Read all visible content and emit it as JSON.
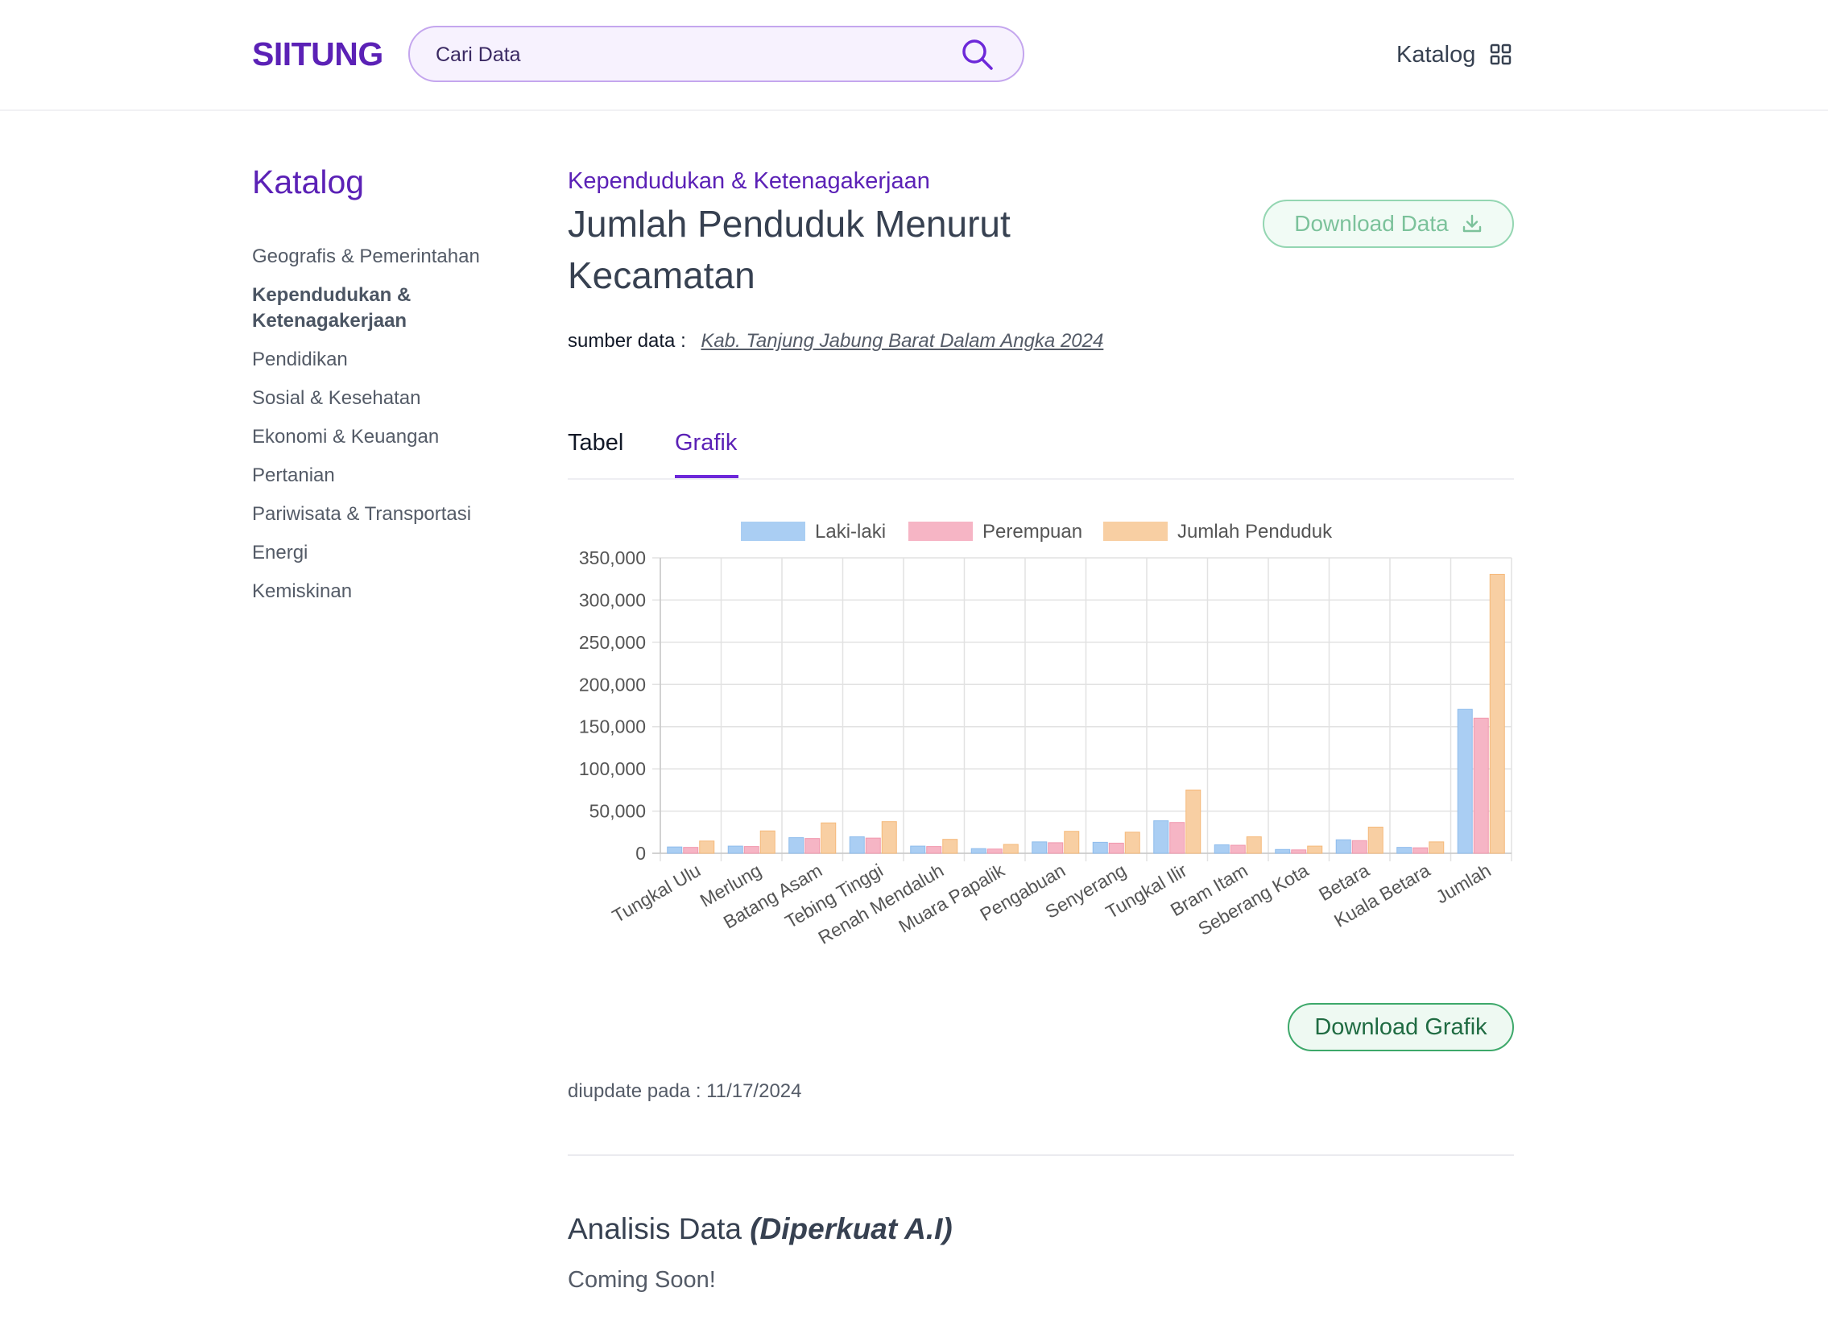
{
  "header": {
    "logo": "SIITUNG",
    "search_placeholder": "Cari Data",
    "katalog_label": "Katalog"
  },
  "sidebar": {
    "title": "Katalog",
    "items": [
      {
        "label": "Geografis & Pemerintahan",
        "active": false
      },
      {
        "label": "Kependudukan & Ketenagakerjaan",
        "active": true
      },
      {
        "label": "Pendidikan",
        "active": false
      },
      {
        "label": "Sosial & Kesehatan",
        "active": false
      },
      {
        "label": "Ekonomi & Keuangan",
        "active": false
      },
      {
        "label": "Pertanian",
        "active": false
      },
      {
        "label": "Pariwisata & Transportasi",
        "active": false
      },
      {
        "label": "Energi",
        "active": false
      },
      {
        "label": "Kemiskinan",
        "active": false
      }
    ]
  },
  "main": {
    "category": "Kependudukan & Ketenagakerjaan",
    "title": "Jumlah Penduduk Menurut Kecamatan",
    "download_data_label": "Download Data",
    "source_label": "sumber data :",
    "source_link": "Kab. Tanjung Jabung Barat Dalam Angka 2024",
    "tabs": [
      {
        "label": "Tabel",
        "active": false
      },
      {
        "label": "Grafik",
        "active": true
      }
    ],
    "download_chart_label": "Download Grafik",
    "updated": "diupdate pada : 11/17/2024",
    "analysis_title": "Analisis Data",
    "analysis_title_em": "(Diperkuat A.I)",
    "analysis_body": "Coming Soon!"
  },
  "colors": {
    "brand": "#5b21b6",
    "laki": "#aacef3",
    "perempuan": "#f6b5c5",
    "jumlah": "#f8cfa3"
  },
  "chart_data": {
    "type": "bar",
    "categories": [
      "Tungkal Ulu",
      "Merlung",
      "Batang Asam",
      "Tebing Tinggi",
      "Renah Mendaluh",
      "Muara Papalik",
      "Pengabuan",
      "Senyerang",
      "Tungkal Ilir",
      "Bram Itam",
      "Seberang Kota",
      "Betara",
      "Kuala Betara",
      "Jumlah"
    ],
    "series": [
      {
        "name": "Laki-laki",
        "values": [
          7500,
          8500,
          18500,
          19500,
          8500,
          5500,
          13500,
          13000,
          38500,
          10000,
          4500,
          16000,
          7000,
          170500
        ]
      },
      {
        "name": "Perempuan",
        "values": [
          7000,
          8000,
          17500,
          18000,
          8000,
          5000,
          12500,
          12000,
          36500,
          9500,
          4000,
          15000,
          6500,
          160000
        ]
      },
      {
        "name": "Jumlah Penduduk",
        "values": [
          14500,
          26500,
          36000,
          37500,
          16500,
          10500,
          26000,
          25000,
          75000,
          19500,
          8500,
          31000,
          13500,
          330500
        ]
      }
    ],
    "ylim": [
      0,
      350000
    ],
    "yticks": [
      0,
      50000,
      100000,
      150000,
      200000,
      250000,
      300000,
      350000
    ],
    "ytick_labels": [
      "0",
      "50,000",
      "100,000",
      "150,000",
      "200,000",
      "250,000",
      "300,000",
      "350,000"
    ],
    "grid": true,
    "legend_position": "top"
  }
}
